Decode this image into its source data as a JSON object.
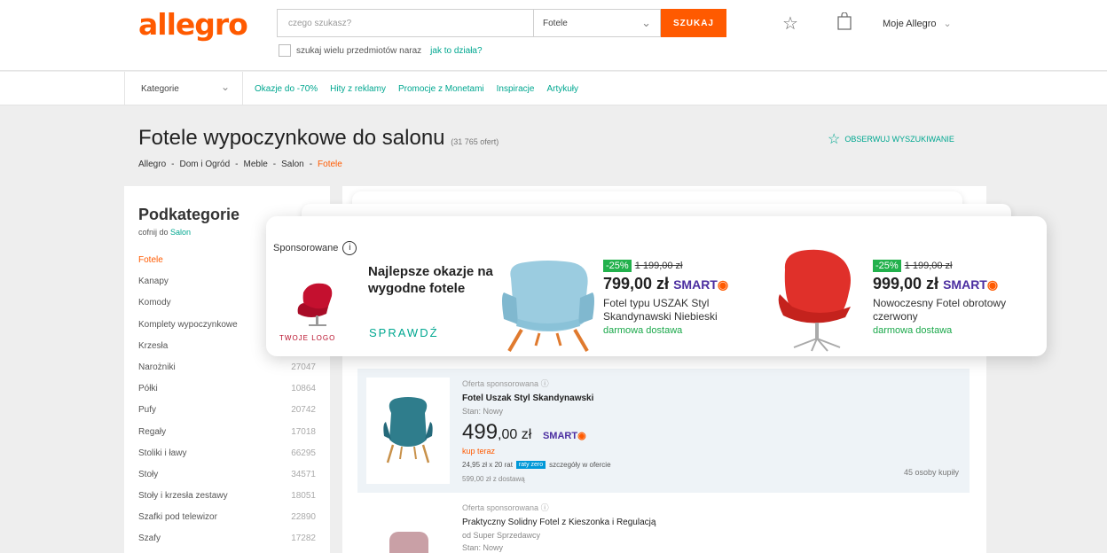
{
  "header": {
    "logo": "allegro",
    "search_placeholder": "czego szukasz?",
    "category": "Fotele",
    "search_button": "SZUKAJ",
    "multi_search": "szukaj wielu przedmiotów naraz",
    "multi_help": "jak to działa?",
    "account": "Moje Allegro"
  },
  "nav": {
    "categories": "Kategorie",
    "links": [
      "Okazje do -70%",
      "Hity z reklamy",
      "Promocje z Monetami",
      "Inspiracje",
      "Artykuły"
    ]
  },
  "page": {
    "title": "Fotele wypoczynkowe do salonu",
    "count": "(31 765 ofert)",
    "observe": "OBSERWUJ WYSZUKIWANIE",
    "breadcrumbs": [
      "Allegro",
      "-",
      "Dom i Ogród",
      "-",
      "Meble",
      "-",
      "Salon",
      "-",
      "Fotele"
    ]
  },
  "sidebar": {
    "title": "Podkategorie",
    "back_prefix": "cofnij do",
    "back_link": "Salon",
    "items": [
      {
        "name": "Fotele",
        "count": ""
      },
      {
        "name": "Kanapy",
        "count": ""
      },
      {
        "name": "Komody",
        "count": ""
      },
      {
        "name": "Komplety wypoczynkowe",
        "count": ""
      },
      {
        "name": "Krzesła",
        "count": ""
      },
      {
        "name": "Narożniki",
        "count": "27047"
      },
      {
        "name": "Półki",
        "count": "10864"
      },
      {
        "name": "Pufy",
        "count": "20742"
      },
      {
        "name": "Regały",
        "count": "17018"
      },
      {
        "name": "Stoliki i ławy",
        "count": "66295"
      },
      {
        "name": "Stoły",
        "count": "34571"
      },
      {
        "name": "Stoły i krzesła zestawy",
        "count": "18051"
      },
      {
        "name": "Szafki pod telewizor",
        "count": "22890"
      },
      {
        "name": "Szafy",
        "count": "17282"
      }
    ]
  },
  "banner": {
    "sponsored": "Sponsorowane",
    "logo_text": "TWOJE LOGO",
    "headline": "Najlepsze okazje na wygodne fotele",
    "cta": "SPRAWDŹ",
    "products": [
      {
        "discount": "-25%",
        "old_price": "1 199,00 zł",
        "price": "799,00 zł",
        "smart": "SMART",
        "name": "Fotel typu USZAK Styl Skandynawski Niebieski",
        "shipping": "darmowa dostawa"
      },
      {
        "discount": "-25%",
        "old_price": "1 199,00 zł",
        "price": "999,00 zł",
        "smart": "SMART",
        "name": "Nowoczesny Fotel obrotowy czerwony",
        "shipping": "darmowa dostawa"
      }
    ]
  },
  "offer1": {
    "sponsored": "Oferta sponsorowana",
    "title": "Fotel Uszak Styl Skandynawski",
    "condition": "Stan: Nowy",
    "price_main": "499",
    "price_rest": ",00 zł",
    "smart": "SMART",
    "buy_now": "kup teraz",
    "installment": "24,95 zł x 20 rat",
    "zero_badge": "raty zero",
    "details": "szczegóły w ofercie",
    "total": "599,00 zł z dostawą",
    "bought": "45 osoby kupiły"
  },
  "offer2": {
    "sponsored": "Oferta sponsorowana",
    "title": "Praktyczny Solidny Fotel z Kieszonka i Regulacją",
    "seller": "od Super Sprzedawcy",
    "condition": "Stan: Nowy"
  },
  "colors": {
    "brand": "#ff5a00",
    "link": "#00a790",
    "smart": "#4b2ea0",
    "discount": "#22b14c"
  }
}
